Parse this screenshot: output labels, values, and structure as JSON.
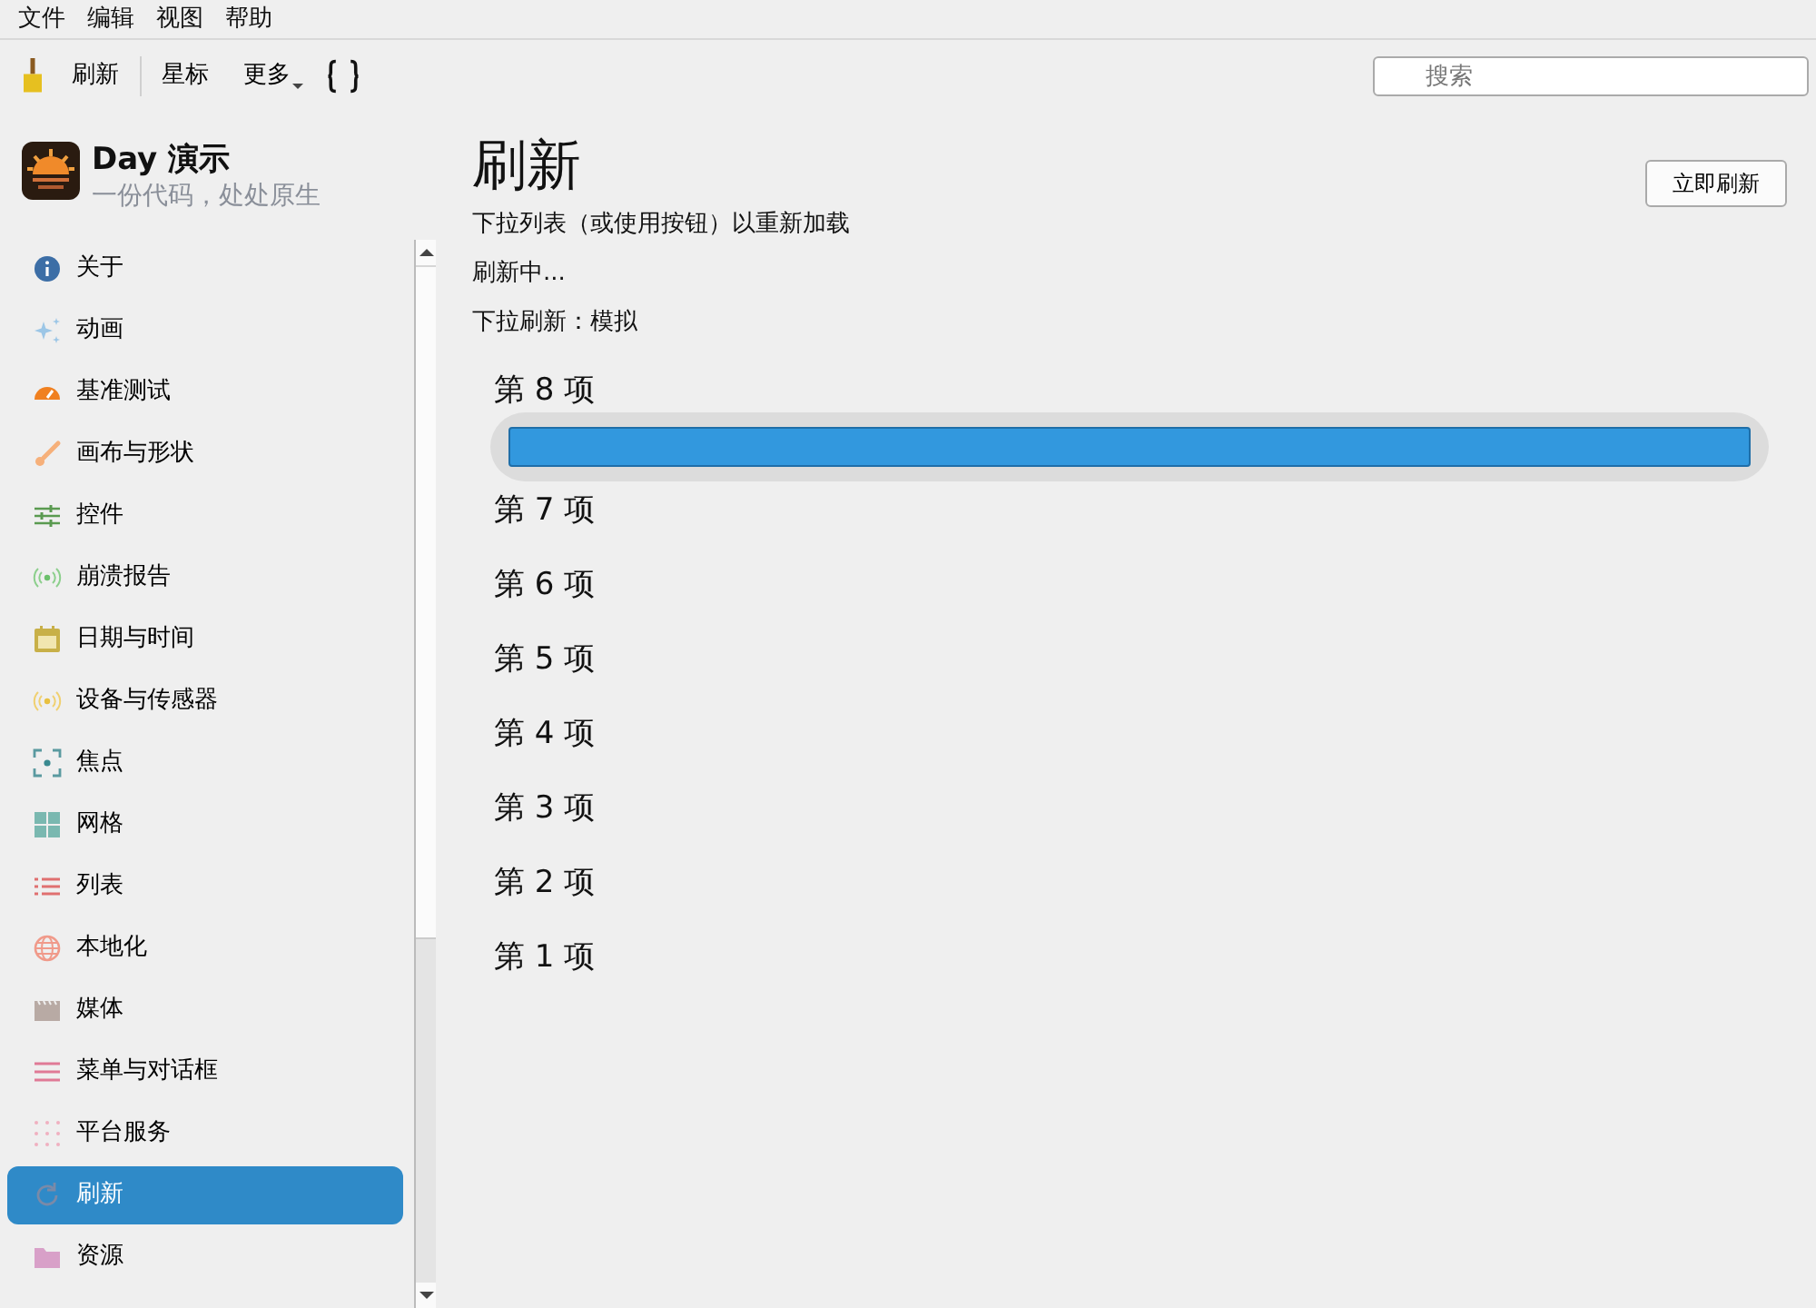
{
  "menu_bar": [
    "文件",
    "编辑",
    "视图",
    "帮助"
  ],
  "toolbar": {
    "buttons": [
      "刷新",
      "星标",
      "更多"
    ],
    "search": {
      "placeholder": "搜索"
    }
  },
  "app": {
    "title": "Day 演示",
    "subtitle": "一份代码，处处原生"
  },
  "sidebar": {
    "items": [
      {
        "label": "关于",
        "selected": false
      },
      {
        "label": "动画",
        "selected": false
      },
      {
        "label": "基准测试",
        "selected": false
      },
      {
        "label": "画布与形状",
        "selected": false
      },
      {
        "label": "控件",
        "selected": false
      },
      {
        "label": "崩溃报告",
        "selected": false
      },
      {
        "label": "日期与时间",
        "selected": false
      },
      {
        "label": "设备与传感器",
        "selected": false
      },
      {
        "label": "焦点",
        "selected": false
      },
      {
        "label": "网格",
        "selected": false
      },
      {
        "label": "列表",
        "selected": false
      },
      {
        "label": "本地化",
        "selected": false
      },
      {
        "label": "媒体",
        "selected": false
      },
      {
        "label": "菜单与对话框",
        "selected": false
      },
      {
        "label": "平台服务",
        "selected": false
      },
      {
        "label": "刷新",
        "selected": true
      },
      {
        "label": "资源",
        "selected": false
      }
    ]
  },
  "page": {
    "title": "刷新",
    "subtitle": "下拉列表（或使用按钮）以重新加载",
    "status": "刷新中...",
    "mode": "下拉刷新：模拟",
    "refresh_button": "立即刷新",
    "progress": {
      "level": 1
    },
    "items": [
      "第 8 项",
      "第 7 项",
      "第 6 项",
      "第 5 项",
      "第 4 项",
      "第 3 项",
      "第 2 项",
      "第 1 项"
    ]
  }
}
